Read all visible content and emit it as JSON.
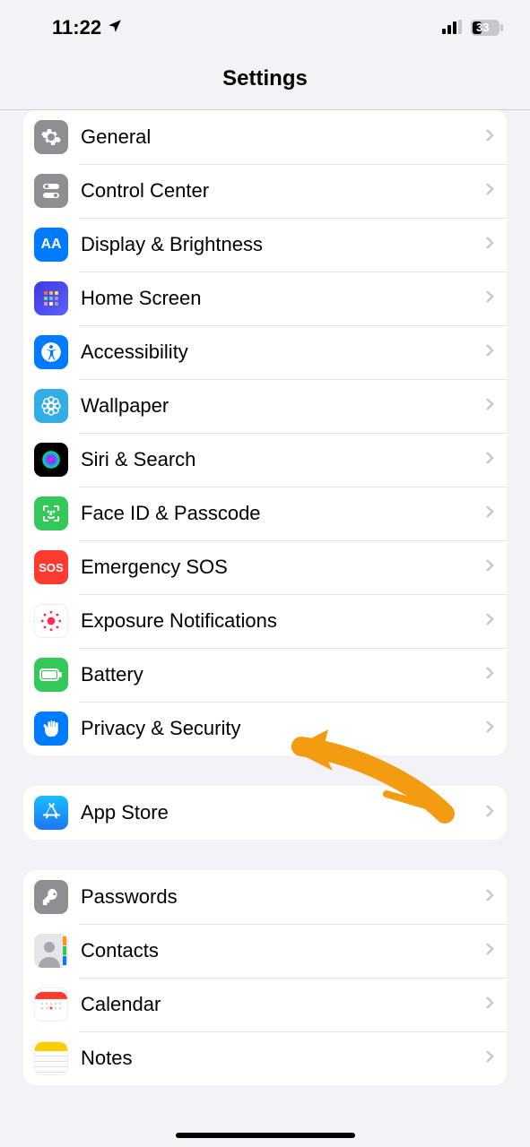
{
  "status": {
    "time": "11:22",
    "battery": "33"
  },
  "title": "Settings",
  "group1": [
    {
      "label": "General",
      "name": "row-general",
      "iconName": "gear-icon"
    },
    {
      "label": "Control Center",
      "name": "row-control-center",
      "iconName": "toggles-icon"
    },
    {
      "label": "Display & Brightness",
      "name": "row-display-brightness",
      "iconName": "aa-icon"
    },
    {
      "label": "Home Screen",
      "name": "row-home-screen",
      "iconName": "apps-grid-icon"
    },
    {
      "label": "Accessibility",
      "name": "row-accessibility",
      "iconName": "accessibility-icon"
    },
    {
      "label": "Wallpaper",
      "name": "row-wallpaper",
      "iconName": "flower-icon"
    },
    {
      "label": "Siri & Search",
      "name": "row-siri-search",
      "iconName": "siri-icon"
    },
    {
      "label": "Face ID & Passcode",
      "name": "row-face-id-passcode",
      "iconName": "face-id-icon"
    },
    {
      "label": "Emergency SOS",
      "name": "row-emergency-sos",
      "iconName": "sos-icon"
    },
    {
      "label": "Exposure Notifications",
      "name": "row-exposure-notifications",
      "iconName": "exposure-icon"
    },
    {
      "label": "Battery",
      "name": "row-battery",
      "iconName": "battery-icon"
    },
    {
      "label": "Privacy & Security",
      "name": "row-privacy-security",
      "iconName": "hand-icon"
    }
  ],
  "group2": [
    {
      "label": "App Store",
      "name": "row-app-store",
      "iconName": "app-store-icon"
    }
  ],
  "group3": [
    {
      "label": "Passwords",
      "name": "row-passwords",
      "iconName": "key-icon"
    },
    {
      "label": "Contacts",
      "name": "row-contacts",
      "iconName": "contacts-icon"
    },
    {
      "label": "Calendar",
      "name": "row-calendar",
      "iconName": "calendar-icon"
    },
    {
      "label": "Notes",
      "name": "row-notes",
      "iconName": "notes-icon"
    }
  ]
}
